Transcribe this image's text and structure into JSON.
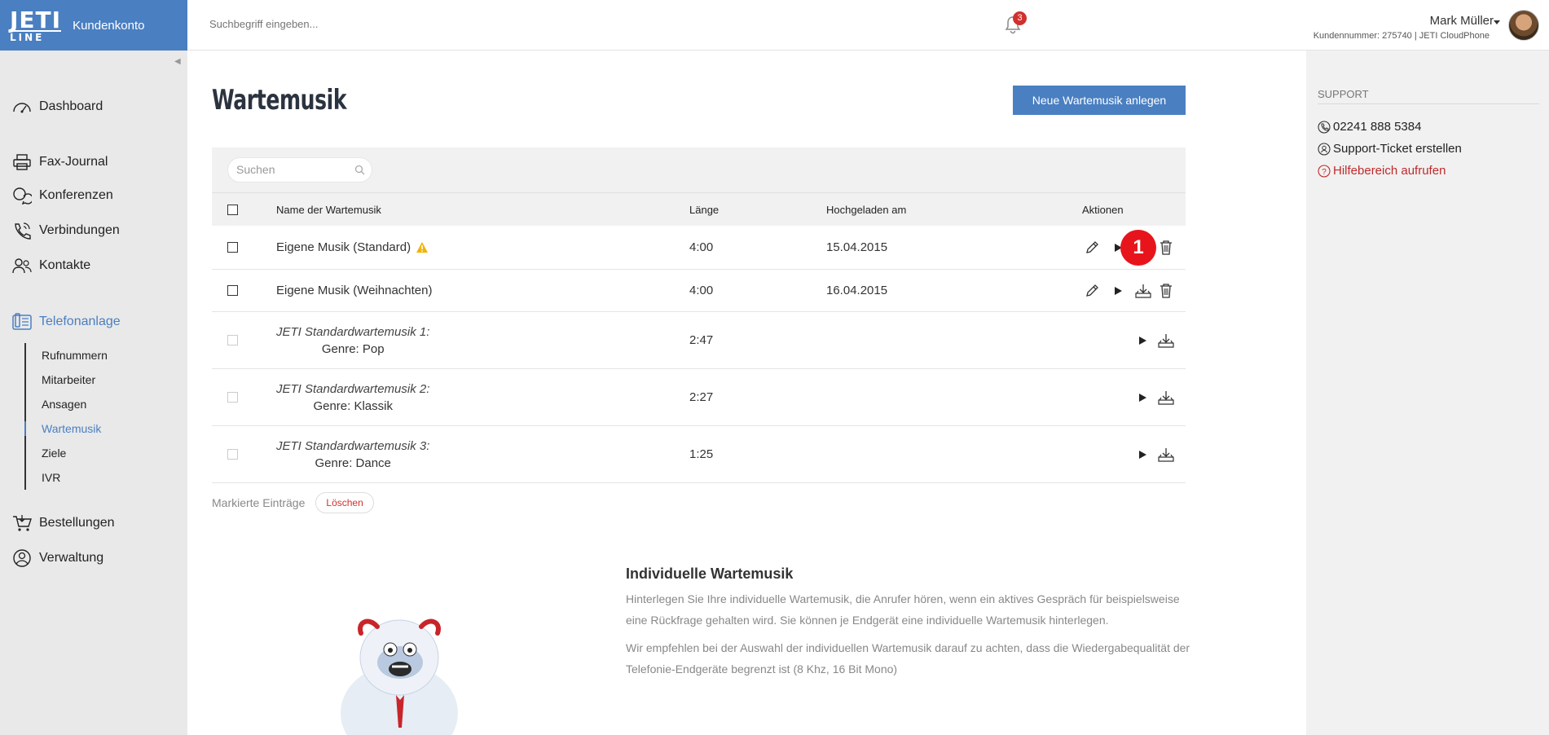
{
  "app": {
    "logo_line1": "JETI",
    "logo_line2": "LINE",
    "section": "Kundenkonto"
  },
  "header": {
    "search_placeholder": "Suchbegriff eingeben...",
    "notifications_count": "3",
    "user_name": "Mark Müller",
    "user_info": "Kundennummer: 275740 | JETI CloudPhone"
  },
  "sidebar": {
    "items": [
      {
        "label": "Dashboard",
        "icon": "speedometer-icon"
      },
      {
        "label": "Fax-Journal",
        "icon": "printer-icon"
      },
      {
        "label": "Konferenzen",
        "icon": "chat-bubbles-icon"
      },
      {
        "label": "Verbindungen",
        "icon": "phone-icon"
      },
      {
        "label": "Kontakte",
        "icon": "contacts-icon"
      },
      {
        "label": "Telefonanlage",
        "icon": "pbx-icon",
        "active": true
      },
      {
        "label": "Bestellungen",
        "icon": "cart-icon"
      },
      {
        "label": "Verwaltung",
        "icon": "user-circle-icon"
      }
    ],
    "subitems": [
      "Rufnummern",
      "Mitarbeiter",
      "Ansagen",
      "Wartemusik",
      "Ziele",
      "IVR"
    ],
    "active_subitem": "Wartemusik"
  },
  "main": {
    "title": "Wartemusik",
    "new_button": "Neue Wartemusik anlegen",
    "search_placeholder": "Suchen",
    "columns": [
      "Name der Wartemusik",
      "Länge",
      "Hochgeladen am",
      "Aktionen"
    ],
    "rows": [
      {
        "name": "Eigene Musik (Standard)",
        "warning": true,
        "length": "4:00",
        "uploaded": "15.04.2015"
      },
      {
        "name": "Eigene Musik (Weihnachten)",
        "length": "4:00",
        "uploaded": "16.04.2015"
      },
      {
        "name": "JETI Standardwartemusik 1:",
        "genre": "Genre: Pop",
        "length": "2:47",
        "uploaded": ""
      },
      {
        "name": "JETI Standardwartemusik 2:",
        "genre": "Genre: Klassik",
        "length": "2:27",
        "uploaded": ""
      },
      {
        "name": "JETI Standardwartemusik 3:",
        "genre": "Genre: Dance",
        "length": "1:25",
        "uploaded": ""
      }
    ],
    "step_marker": "1",
    "bulk_label": "Markierte Einträge",
    "bulk_delete": "Löschen",
    "info_title": "Individuelle Wartemusik",
    "info_p1": "Hinterlegen Sie Ihre individuelle Wartemusik, die Anrufer hören, wenn ein aktives Gespräch für beispielsweise eine Rückfrage gehalten wird. Sie können je Endgerät eine individuelle Wartemusik hinterlegen.",
    "info_p2": "Wir empfehlen bei der Auswahl der individuellen Wartemusik darauf zu achten, dass die Wiedergabequalität der Telefonie-Endgeräte begrenzt ist (8 Khz, 16 Bit Mono)"
  },
  "support": {
    "title": "SUPPORT",
    "phone": "02241 888 5384",
    "ticket": "Support-Ticket erstellen",
    "help": "Hilfebereich aufrufen"
  },
  "colors": {
    "brand": "#4a7fc1",
    "sidebar_bg": "#e9e9e9",
    "danger": "#d0312d",
    "marker": "#e8141c"
  }
}
